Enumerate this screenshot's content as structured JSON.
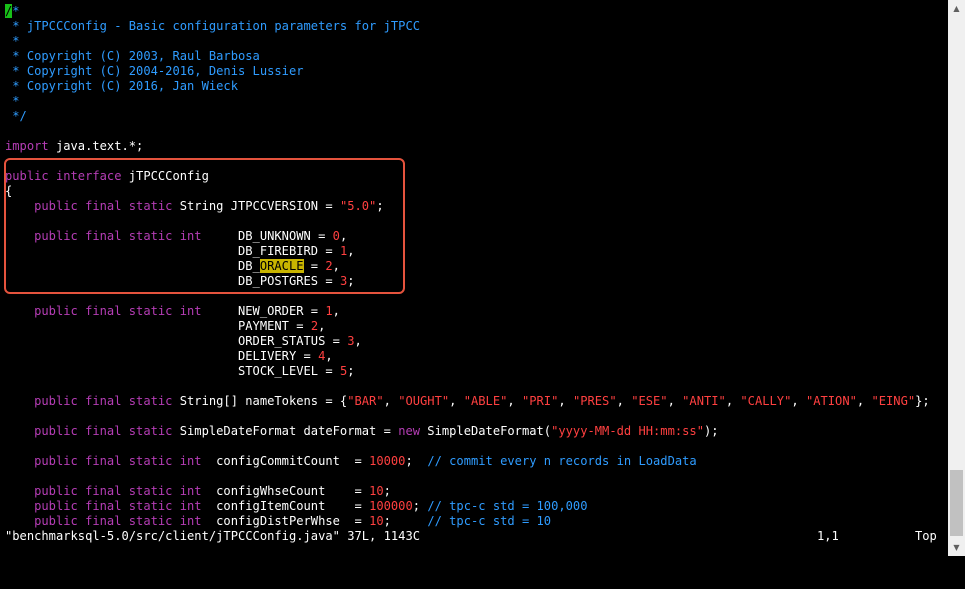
{
  "editor": {
    "lines": [
      [
        {
          "t": "/",
          "c": "cursor"
        },
        {
          "t": "*",
          "c": "c"
        }
      ],
      [
        {
          "t": " * jTPCCConfig - Basic configuration parameters for jTPCC",
          "c": "c"
        }
      ],
      [
        {
          "t": " *",
          "c": "c"
        }
      ],
      [
        {
          "t": " * Copyright (C) 2003, Raul Barbosa",
          "c": "c"
        }
      ],
      [
        {
          "t": " * Copyright (C) 2004-2016, Denis Lussier",
          "c": "c"
        }
      ],
      [
        {
          "t": " * Copyright (C) 2016, Jan Wieck",
          "c": "c"
        }
      ],
      [
        {
          "t": " *",
          "c": "c"
        }
      ],
      [
        {
          "t": " */",
          "c": "c"
        }
      ],
      [],
      [
        {
          "t": "import",
          "c": "k"
        },
        {
          "t": " java.text.*;",
          "c": "w"
        }
      ],
      [],
      [
        {
          "t": "public interface",
          "c": "k"
        },
        {
          "t": " jTPCCConfig",
          "c": "w"
        }
      ],
      [
        {
          "t": "{",
          "c": "w"
        }
      ],
      [
        {
          "t": "    public final static",
          "c": "k"
        },
        {
          "t": " String JTPCCVERSION = ",
          "c": "w"
        },
        {
          "t": "\"5.0\"",
          "c": "n"
        },
        {
          "t": ";",
          "c": "w"
        }
      ],
      [],
      [
        {
          "t": "    public final static int",
          "c": "k"
        },
        {
          "t": "     DB_UNKNOWN = ",
          "c": "w"
        },
        {
          "t": "0",
          "c": "n"
        },
        {
          "t": ",",
          "c": "w"
        }
      ],
      [
        {
          "t": "                                DB_FIREBIRD = ",
          "c": "w"
        },
        {
          "t": "1",
          "c": "n"
        },
        {
          "t": ",",
          "c": "w"
        }
      ],
      [
        {
          "t": "                                DB_",
          "c": "w"
        },
        {
          "t": "ORACLE",
          "c": "hl"
        },
        {
          "t": " = ",
          "c": "w"
        },
        {
          "t": "2",
          "c": "n"
        },
        {
          "t": ",",
          "c": "w"
        }
      ],
      [
        {
          "t": "                                DB_POSTGRES = ",
          "c": "w"
        },
        {
          "t": "3",
          "c": "n"
        },
        {
          "t": ";",
          "c": "w"
        }
      ],
      [],
      [
        {
          "t": "    public final static int",
          "c": "k"
        },
        {
          "t": "     NEW_ORDER = ",
          "c": "w"
        },
        {
          "t": "1",
          "c": "n"
        },
        {
          "t": ",",
          "c": "w"
        }
      ],
      [
        {
          "t": "                                PAYMENT = ",
          "c": "w"
        },
        {
          "t": "2",
          "c": "n"
        },
        {
          "t": ",",
          "c": "w"
        }
      ],
      [
        {
          "t": "                                ORDER_STATUS = ",
          "c": "w"
        },
        {
          "t": "3",
          "c": "n"
        },
        {
          "t": ",",
          "c": "w"
        }
      ],
      [
        {
          "t": "                                DELIVERY = ",
          "c": "w"
        },
        {
          "t": "4",
          "c": "n"
        },
        {
          "t": ",",
          "c": "w"
        }
      ],
      [
        {
          "t": "                                STOCK_LEVEL = ",
          "c": "w"
        },
        {
          "t": "5",
          "c": "n"
        },
        {
          "t": ";",
          "c": "w"
        }
      ],
      [],
      [
        {
          "t": "    public final static",
          "c": "k"
        },
        {
          "t": " String[] nameTokens = {",
          "c": "w"
        },
        {
          "t": "\"BAR\"",
          "c": "n"
        },
        {
          "t": ", ",
          "c": "w"
        },
        {
          "t": "\"OUGHT\"",
          "c": "n"
        },
        {
          "t": ", ",
          "c": "w"
        },
        {
          "t": "\"ABLE\"",
          "c": "n"
        },
        {
          "t": ", ",
          "c": "w"
        },
        {
          "t": "\"PRI\"",
          "c": "n"
        },
        {
          "t": ", ",
          "c": "w"
        },
        {
          "t": "\"PRES\"",
          "c": "n"
        },
        {
          "t": ", ",
          "c": "w"
        },
        {
          "t": "\"ESE\"",
          "c": "n"
        },
        {
          "t": ", ",
          "c": "w"
        },
        {
          "t": "\"ANTI\"",
          "c": "n"
        },
        {
          "t": ", ",
          "c": "w"
        },
        {
          "t": "\"CALLY\"",
          "c": "n"
        },
        {
          "t": ", ",
          "c": "w"
        },
        {
          "t": "\"ATION\"",
          "c": "n"
        },
        {
          "t": ", ",
          "c": "w"
        },
        {
          "t": "\"EING\"",
          "c": "n"
        },
        {
          "t": "};",
          "c": "w"
        }
      ],
      [],
      [
        {
          "t": "    public final static",
          "c": "k"
        },
        {
          "t": " SimpleDateFormat dateFormat = ",
          "c": "w"
        },
        {
          "t": "new",
          "c": "k"
        },
        {
          "t": " SimpleDateFormat(",
          "c": "w"
        },
        {
          "t": "\"yyyy-MM-dd HH:mm:ss\"",
          "c": "n"
        },
        {
          "t": ");",
          "c": "w"
        }
      ],
      [],
      [
        {
          "t": "    public final static int",
          "c": "k"
        },
        {
          "t": "  configCommitCount  = ",
          "c": "w"
        },
        {
          "t": "10000",
          "c": "n"
        },
        {
          "t": ";  ",
          "c": "w"
        },
        {
          "t": "// commit every n records in LoadData",
          "c": "c"
        }
      ],
      [],
      [
        {
          "t": "    public final static int",
          "c": "k"
        },
        {
          "t": "  configWhseCount    = ",
          "c": "w"
        },
        {
          "t": "10",
          "c": "n"
        },
        {
          "t": ";",
          "c": "w"
        }
      ],
      [
        {
          "t": "    public final static int",
          "c": "k"
        },
        {
          "t": "  configItemCount    = ",
          "c": "w"
        },
        {
          "t": "100000",
          "c": "n"
        },
        {
          "t": "; ",
          "c": "w"
        },
        {
          "t": "// tpc-c std = 100,000",
          "c": "c"
        }
      ],
      [
        {
          "t": "    public final static int",
          "c": "k"
        },
        {
          "t": "  configDistPerWhse  = ",
          "c": "w"
        },
        {
          "t": "10",
          "c": "n"
        },
        {
          "t": ";     ",
          "c": "w"
        },
        {
          "t": "// tpc-c std = 10",
          "c": "c"
        }
      ]
    ]
  },
  "status": {
    "file": "\"benchmarksql-5.0/src/client/jTPCCConfig.java\" 37L, 1143C",
    "position": "1,1",
    "scroll": "Top"
  },
  "scrollbar": {
    "up_arrow": "▲",
    "down_arrow": "▼",
    "position_fraction": 0.0
  },
  "colors": {
    "background": "#000000",
    "comment": "#2f9cff",
    "keyword": "#b53db5",
    "literal": "#ff4040",
    "search_highlight": "#c8b400",
    "cursor": "#18c018",
    "annotation_box": "#e5533d"
  }
}
